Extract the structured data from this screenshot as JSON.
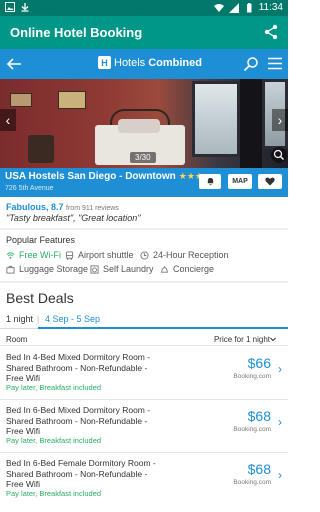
{
  "status_bar": {
    "time": "11:34"
  },
  "app_bar": {
    "title": "Online Hotel Booking"
  },
  "web_header": {
    "logo_part1": "Hotels",
    "logo_part2": "Combined"
  },
  "gallery": {
    "counter": "3/30"
  },
  "hotel": {
    "name": "USA Hostels San Diego - Downtown",
    "stars": "★★★",
    "address": "726 5th Avenue",
    "map_label": "MAP"
  },
  "review": {
    "rating_text": "Fabulous, 8.7",
    "count_text": "from 911 reviews",
    "quote": "\"Tasty breakfast\", \"Great location\""
  },
  "features": {
    "title": "Popular Features",
    "items": [
      "Free Wi-Fi",
      "Airport shuttle",
      "24-Hour Reception",
      "Luggage Storage",
      "Self Laundry",
      "Concierge"
    ]
  },
  "deals": {
    "title": "Best Deals",
    "tab_nights": "1 night",
    "tab_sep": "|",
    "tab_dates": "4 Sep - 5 Sep",
    "col_room": "Room",
    "col_price": "Price for 1 night",
    "items": [
      {
        "room": "Bed In 4-Bed Mixed Dormitory Room - Shared Bathroom - Non-Refundable - Free Wifi",
        "tag": "Pay later, Breakfast included",
        "price": "$66",
        "site": "Booking.com"
      },
      {
        "room": "Bed In 6-Bed Mixed Dormitory Room - Shared Bathroom - Non-Refundable - Free Wifi",
        "tag": "Pay later, Breakfast included",
        "price": "$68",
        "site": "Booking.com"
      },
      {
        "room": "Bed In 6-Bed Female Dormitory Room - Shared Bathroom - Non-Refundable - Free Wifi",
        "tag": "Pay later, Breakfast included",
        "price": "$68",
        "site": "Booking.com"
      }
    ]
  },
  "colors": {
    "teal": "#009688",
    "blue": "#1e8fd5",
    "green": "#27ae60",
    "star": "#ffd54f"
  }
}
